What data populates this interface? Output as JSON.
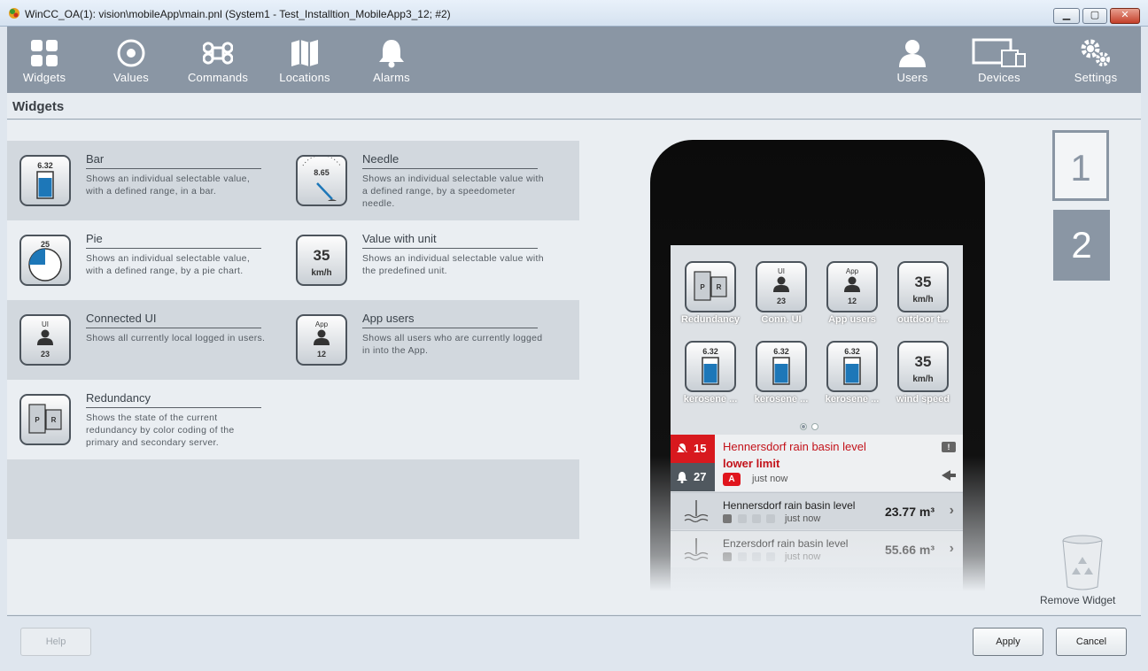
{
  "window": {
    "title": "WinCC_OA(1): vision\\mobileApp\\main.pnl (System1 - Test_Installtion_MobileApp3_12; #2)",
    "min": "▁",
    "max": "▢",
    "close": "✕"
  },
  "toolbar": {
    "items": [
      {
        "label": "Widgets",
        "icon": "widgets-icon"
      },
      {
        "label": "Values",
        "icon": "values-icon"
      },
      {
        "label": "Commands",
        "icon": "commands-icon"
      },
      {
        "label": "Locations",
        "icon": "locations-icon"
      },
      {
        "label": "Alarms",
        "icon": "alarms-icon"
      },
      {
        "label": "Users",
        "icon": "users-icon"
      },
      {
        "label": "Devices",
        "icon": "devices-icon"
      },
      {
        "label": "Settings",
        "icon": "settings-icon"
      }
    ]
  },
  "section": {
    "title": "Widgets"
  },
  "widgets": [
    {
      "name": "Bar",
      "desc": "Shows an individual selectable value, with a defined range, in a bar.",
      "icon_value": "6.32"
    },
    {
      "name": "Needle",
      "desc": "Shows an individual selectable value with a defined range, by a speedometer needle.",
      "icon_value": "8.65"
    },
    {
      "name": "Pie",
      "desc": "Shows an individual selectable value, with a defined range, by a pie chart.",
      "icon_value": "25"
    },
    {
      "name": "Value with unit",
      "desc": "Shows an individual selectable value with the predefined unit.",
      "icon_value": "35",
      "icon_unit": "km/h"
    },
    {
      "name": "Connected UI",
      "desc": "Shows all currently local logged in users.",
      "icon_top": "UI",
      "icon_value": "23"
    },
    {
      "name": "App users",
      "desc": "Shows all users who are currently logged in into the App.",
      "icon_top": "App",
      "icon_value": "12"
    },
    {
      "name": "Redundancy",
      "desc": "Shows the state of the current redundancy by color coding of the primary and secondary server.",
      "icon_p": "P",
      "icon_r": "R"
    }
  ],
  "preview": {
    "tiles": [
      {
        "label": "Redundancy"
      },
      {
        "label": "Conn. UI",
        "top": "UI",
        "value": "23"
      },
      {
        "label": "App users",
        "top": "App",
        "value": "12"
      },
      {
        "label": "outdoor t...",
        "value": "35",
        "unit": "km/h"
      },
      {
        "label": "kerosene ...",
        "value": "6.32"
      },
      {
        "label": "kerosene ...",
        "value": "6.32"
      },
      {
        "label": "kerosene ...",
        "value": "6.32"
      },
      {
        "label": "wind speed",
        "value": "35",
        "unit": "km/h"
      }
    ],
    "alarm": {
      "count_red": "15",
      "count_dark": "27",
      "title": "Hennersdorf rain basin level",
      "subtitle": "lower limit",
      "badge": "A",
      "time": "just now",
      "excl": "!"
    },
    "values": [
      {
        "name": "Hennersdorf rain basin level",
        "time": "just now",
        "value": "23.77 m³"
      },
      {
        "name": "Enzersdorf rain basin level",
        "time": "just now",
        "value": "55.66 m³"
      }
    ]
  },
  "pages": {
    "p1": "1",
    "p2": "2"
  },
  "remove_widget": "Remove Widget",
  "footer": {
    "help": "Help",
    "apply": "Apply",
    "cancel": "Cancel"
  },
  "colors": {
    "toolbar": "#8a96a4",
    "alarm_red": "#d8191e",
    "value_blue": "#1d77b8"
  }
}
